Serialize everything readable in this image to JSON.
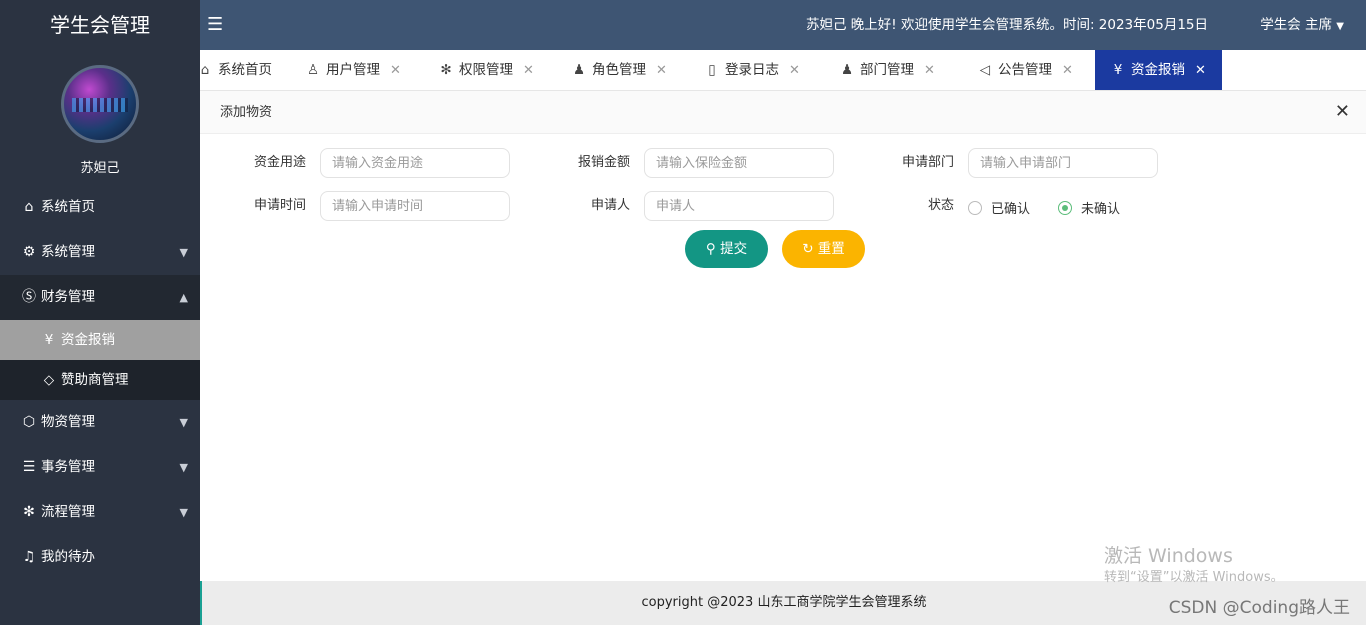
{
  "app": {
    "title": "学生会管理"
  },
  "user": {
    "name": "苏妲己"
  },
  "header": {
    "greeting": "苏妲己 晚上好!  欢迎使用学生会管理系统。时间:  2023年05月15日",
    "role": "学生会 主席",
    "role_caret": "▼",
    "menu_icon": "hamburger-icon"
  },
  "sidebar": {
    "items": [
      {
        "label": "系统首页",
        "icon": "home-icon",
        "glyph": "⌂"
      },
      {
        "label": "系统管理",
        "icon": "gear-icon",
        "glyph": "⚙",
        "caret": "▼"
      },
      {
        "label": "财务管理",
        "icon": "dollar-circle-icon",
        "glyph": "Ⓢ",
        "caret": "▲"
      },
      {
        "label": "物资管理",
        "icon": "cube-icon",
        "glyph": "⬡",
        "caret": "▼"
      },
      {
        "label": "事务管理",
        "icon": "sliders-icon",
        "glyph": "☰",
        "caret": "▼"
      },
      {
        "label": "流程管理",
        "icon": "snowflake-icon",
        "glyph": "✻",
        "caret": "▼"
      },
      {
        "label": "我的待办",
        "icon": "bell-icon",
        "glyph": "♫"
      }
    ],
    "finance_sub": [
      {
        "label": "资金报销",
        "icon": "yen-circle-icon",
        "glyph": "¥"
      },
      {
        "label": "赞助商管理",
        "icon": "diamond-icon",
        "glyph": "◇"
      }
    ]
  },
  "tabs": [
    {
      "label": "系统首页",
      "icon": "home-icon",
      "glyph": "⌂"
    },
    {
      "label": "用户管理",
      "icon": "user-icon",
      "glyph": "♙",
      "close": "✕"
    },
    {
      "label": "权限管理",
      "icon": "snowflake-icon",
      "glyph": "✻",
      "close": "✕"
    },
    {
      "label": "角色管理",
      "icon": "person-icon",
      "glyph": "♟",
      "close": "✕"
    },
    {
      "label": "登录日志",
      "icon": "file-icon",
      "glyph": "▯",
      "close": "✕"
    },
    {
      "label": "部门管理",
      "icon": "group-icon",
      "glyph": "♟",
      "close": "✕"
    },
    {
      "label": "公告管理",
      "icon": "speaker-icon",
      "glyph": "◁",
      "close": "✕"
    },
    {
      "label": "资金报销",
      "icon": "yen-circle-icon",
      "glyph": "¥",
      "close": "✕"
    }
  ],
  "panel": {
    "title": "添加物资",
    "close": "✕"
  },
  "form": {
    "purpose": {
      "label": "资金用途",
      "placeholder": "请输入资金用途"
    },
    "amount": {
      "label": "报销金额",
      "placeholder": "请输入保险金额"
    },
    "dept": {
      "label": "申请部门",
      "placeholder": "请输入申请部门"
    },
    "time": {
      "label": "申请时间",
      "placeholder": "请输入申请时间"
    },
    "applicant": {
      "label": "申请人",
      "placeholder": "申请人"
    },
    "status": {
      "label": "状态",
      "options": [
        "已确认",
        "未确认"
      ],
      "selected": "未确认"
    },
    "submit": "提交",
    "reset": "重置"
  },
  "footer": {
    "text": "copyright @2023 山东工商学院学生会管理系统"
  },
  "watermark": {
    "line1": "激活 Windows",
    "line2": "转到“设置”以激活 Windows。",
    "csdn": "CSDN @Coding路人王"
  }
}
